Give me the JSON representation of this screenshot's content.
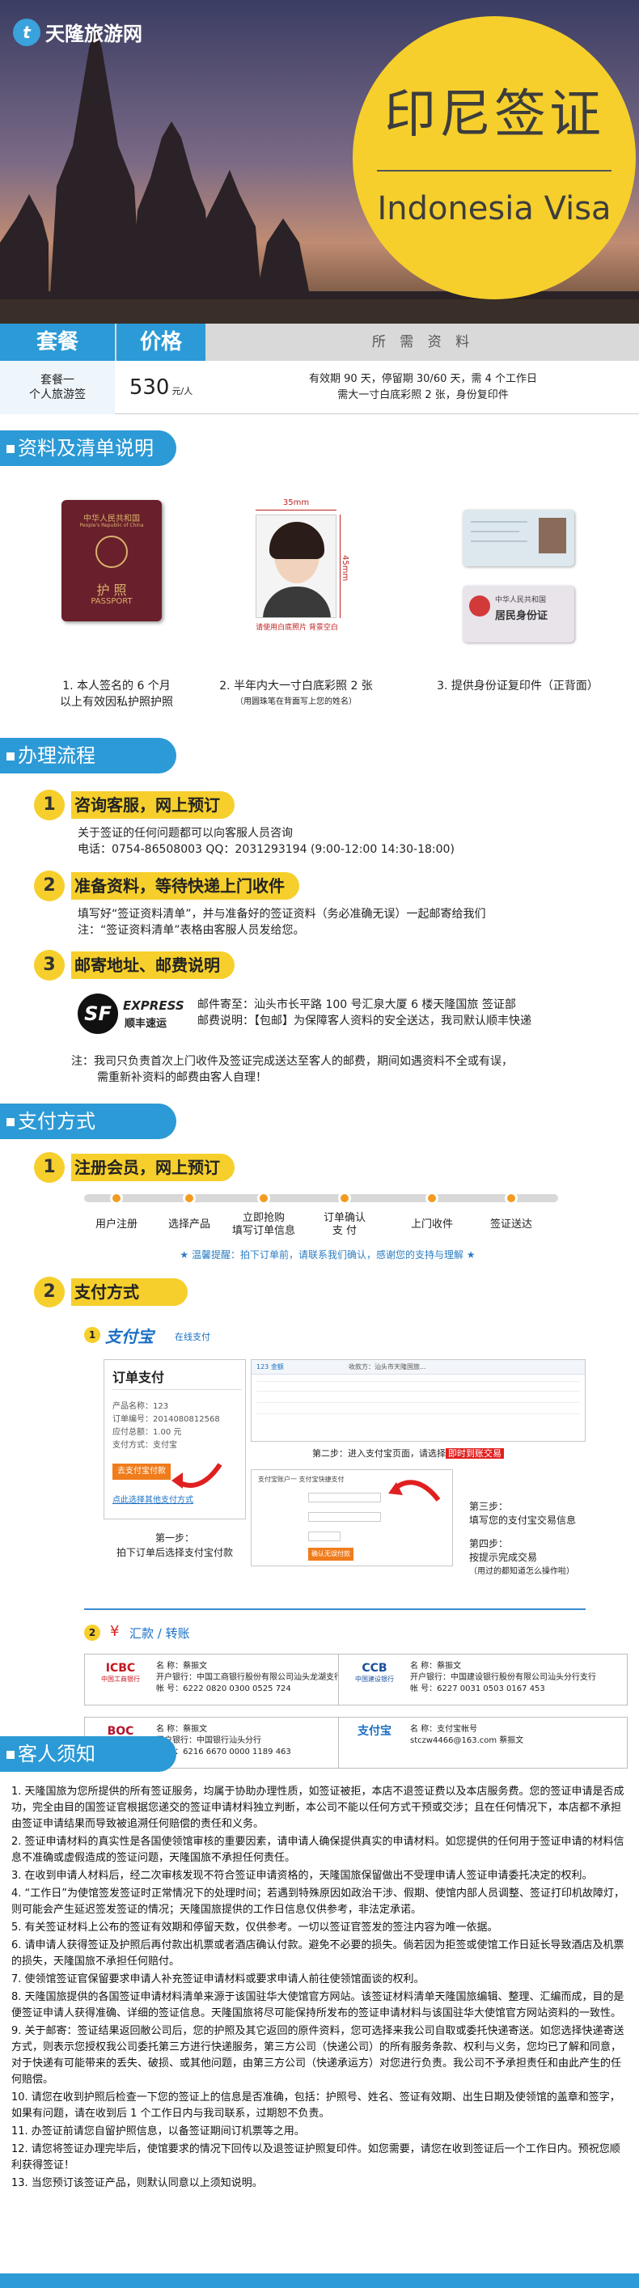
{
  "hero": {
    "logo_text": "天隆旅游网",
    "title_cn": "印尼签证",
    "title_en": "Indonesia Visa"
  },
  "package_header": {
    "col1": "套餐",
    "col2": "价格",
    "col3": "所 需 资 料"
  },
  "package_row": {
    "name_line1": "套餐一",
    "name_line2": "个人旅游签",
    "price": "530",
    "price_unit": "元/人",
    "info_line1": "有效期 90 天，停留期 30/60 天，需 4 个工作日",
    "info_line2": "需大一寸白底彩照 2 张，身份复印件"
  },
  "materials": {
    "section_title": "资料及清单说明",
    "photo_width": "35mm",
    "photo_height": "45mm",
    "photo_note": "请使用白底照片 背景空白",
    "passport_cn": "中华人民共和国",
    "passport_en": "People's Republic of China",
    "passport_huzhao": "护 照",
    "passport_label": "PASSPORT",
    "idcard_cn": "中华人民共和国",
    "idcard_title": "居民身份证",
    "item1_line1": "1. 本人签名的 6 个月",
    "item1_line2": "以上有效因私护照护照",
    "item2_line1": "2. 半年内大一寸白底彩照 2 张",
    "item2_line2": "（用圆珠笔在背面写上您的姓名）",
    "item3": "3. 提供身份证复印件（正背面）"
  },
  "process": {
    "section_title": "办理流程",
    "step1_num": "1",
    "step1_title": "咨询客服，网上预订",
    "step1_text1": "关于签证的任何问题都可以向客服人员咨询",
    "step1_text2": "电话：0754-86508003    QQ：2031293194  (9:00-12:00  14:30-18:00)",
    "step2_num": "2",
    "step2_title": "准备资料，等待快递上门收件",
    "step2_text1": "填写好“签证资料清单”，并与准备好的签证资料（务必准确无误）一起邮寄给我们",
    "step2_text2": "注：“签证资料清单”表格由客服人员发给您。",
    "step3_num": "3",
    "step3_title": "邮寄地址、邮费说明",
    "sf_logo": "SF",
    "sf_express": "EXPRESS",
    "sf_cn": "顺丰速运",
    "step3_text1": "邮件寄至：汕头市长平路 100 号汇泉大厦 6 楼天隆国旅 签证部",
    "step3_text2": "邮费说明：【包邮】为保障客人资料的安全送达，我司默认顺丰快递",
    "note1": "注：我司只负责首次上门收件及签证完成送达至客人的邮费，期间如遇资料不全或有误，",
    "note2": "需重新补资料的邮费由客人自理！"
  },
  "payment": {
    "section_title": "支付方式",
    "step1_num": "1",
    "step1_title": "注册会员，网上预订",
    "flow": [
      "用户注册",
      "选择产品",
      "立即抢购\n填写订单信息",
      "订单确认\n支    付",
      "上门收件",
      "签证送达"
    ],
    "flow_tip": "★ 温馨提醒：拍下订单前，请联系我们确认，感谢您的支持与理解 ★",
    "step2_num": "2",
    "step2_title": "支付方式",
    "alipay_circle": "1",
    "alipay_logo": "支付宝",
    "alipay_online": "在线支付",
    "order_title": "订单支付",
    "order_name": "产品名称：123",
    "order_no": "订单编号：2014080812568",
    "order_total": "应付总额：1.00 元",
    "order_method": "支付方式：支付宝",
    "pay_btn": "去支付宝付款",
    "change_link": "点此选择其他支付方式",
    "step_a1": "第一步：",
    "step_a2": "拍下订单后选择支付宝付款",
    "mock_top_left": "123 金额",
    "mock_top_right": "收款方：汕头市天隆国旅...",
    "step_b": "第二步：进入支付宝页面，请选择",
    "step_b_highlight": "即时到账交易",
    "mock_login_title": "支付宝账户一 支付宝快捷支付",
    "step_c1": "第三步：",
    "step_c2": "填写您的支付宝交易信息",
    "step_d1": "第四步：",
    "step_d2": "按提示完成交易",
    "step_d3": "（用过的都知道怎么操作啦）",
    "mock_confirm_btn": "确认无误付款",
    "remit_circle": "2",
    "remit_title": "汇款 / 转账"
  },
  "banks": [
    {
      "logo": "ICBC",
      "logo_sub": "中国工商银行",
      "name": "名    称：蔡振文",
      "bank": "开户银行：中国工商银行股份有限公司汕头龙湖支行",
      "acct": "帐    号：6222 0820 0300 0525 724",
      "color": "#c8161e"
    },
    {
      "logo": "CCB",
      "logo_sub": "中国建设银行",
      "name": "名    称：蔡振文",
      "bank": "开户银行：中国建设银行股份有限公司汕头分行支行",
      "acct": "帐    号：6227 0031 0503 0167 453",
      "color": "#1b4f9c"
    },
    {
      "logo": "BOC",
      "logo_sub": "中国银行",
      "name": "名    称：蔡振文",
      "bank": "开户银行：中国银行汕头分行",
      "acct": "帐    号：6216 6670 0000 1189 463",
      "color": "#b3142b"
    },
    {
      "logo": "支付宝",
      "logo_sub": "",
      "name": "名    称：支付宝帐号",
      "bank": "stczw4466@163.com    蔡振文",
      "acct": "",
      "color": "#1a6fc4"
    }
  ],
  "notes": {
    "section_title": "客人须知",
    "items": [
      "1. 天隆国旅为您所提供的所有签证服务，均属于协助办理性质，如签证被拒，本店不退签证费以及本店服务费。您的签证申请是否成功，完全由目的国签证官根据您递交的签证申请材料独立判断，本公司不能以任何方式干预或交涉；且在任何情况下，本店都不承担由签证申请结果而导致被追溯任何赔偿的责任和义务。",
      "2. 签证申请材料的真实性是各国使领馆审核的重要因素，请申请人确保提供真实的申请材料。如您提供的任何用于签证申请的材料信息不准确或虚假造成的签证问题，天隆国旅不承担任何责任。",
      "3. 在收到申请人材料后，经二次审核发现不符合签证申请资格的，天隆国旅保留做出不受理申请人签证申请委托决定的权利。",
      "4. “工作日”为使馆签发签证时正常情况下的处理时间；若遇到特殊原因如政治干涉、假期、使馆内部人员调整、签证打印机故障灯，则可能会产生延迟签发签证的情况；天隆国旅提供的工作日信息仅供参考，非法定承诺。",
      "5. 有关签证材料上公布的签证有效期和停留天数，仅供参考。一切以签证官签发的签注内容为唯一依据。",
      "6. 请申请人获得签证及护照后再付款出机票或者酒店确认付款。避免不必要的损失。倘若因为拒签或使馆工作日延长导致酒店及机票的损失，天隆国旅不承担任何赔付。",
      "7. 使领馆签证官保留要求申请人补充签证申请材料或要求申请人前往使领馆面谈的权利。",
      "8. 天隆国旅提供的各国签证申请材料清单来源于该国驻华大使馆官方网站。该签证材料清单天隆国旅编辑、整理、汇编而成，目的是便签证申请人获得准确、详细的签证信息。天隆国旅将尽可能保持所发布的签证申请材料与该国驻华大使馆官方网站资料的一致性。",
      "9. 关于邮寄：签证结果返回敝公司后，您的护照及其它返回的原件资料，您可选择来我公司自取或委托快递寄送。如您选择快递寄送方式，则表示您授权我公司委托第三方进行快递服务，第三方公司（快递公司）的所有服务条款、权利与义务，您均已了解和同意，对于快递有可能带来的丢失、破损、或其他问题，由第三方公司（快递承运方）对您进行负责。我公司不予承担责任和由此产生的任何赔偿。",
      "10. 请您在收到护照后检查一下您的签证上的信息是否准确，包括：护照号、姓名、签证有效期、出生日期及使领馆的盖章和签字，如果有问题，请在收到后 1 个工作日内与我司联系，过期恕不负责。",
      "11. 办签证前请您自留护照信息，以备签证期间订机票等之用。",
      "12. 请您将签证办理完毕后，使馆要求的情况下回传以及退签证护照复印件。如您需要，请您在收到签证后一个工作日内。预祝您顺利获得签证！",
      "13. 当您预订该签证产品，则默认同意以上须知说明。"
    ]
  },
  "colors": {
    "brand_blue": "#2c9ad6",
    "accent_yellow": "#f6cf2c",
    "alert_red": "#e02020"
  }
}
